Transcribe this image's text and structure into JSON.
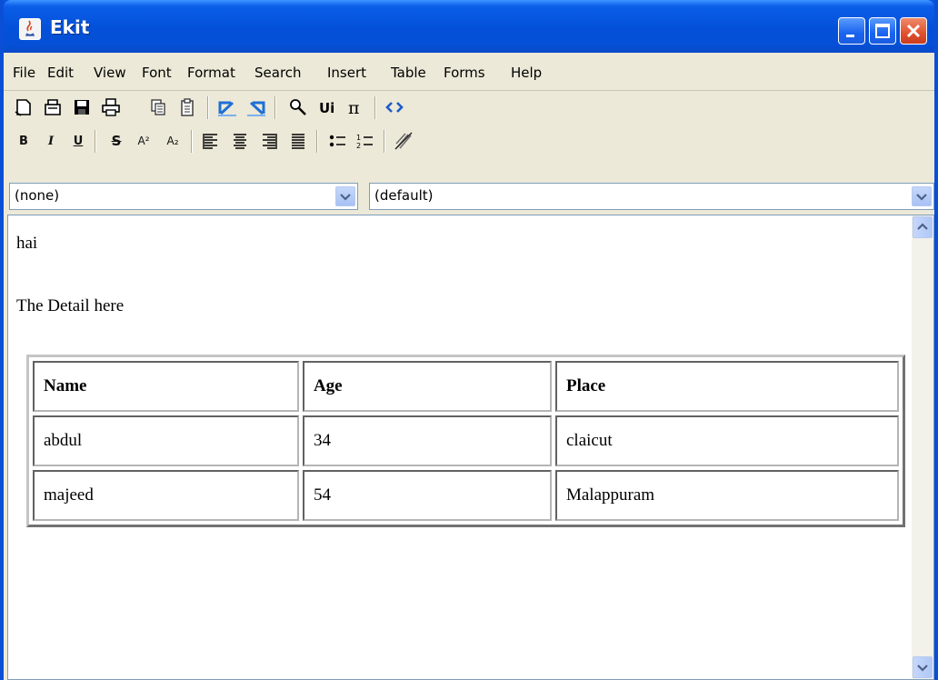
{
  "window": {
    "title": "Ekit"
  },
  "menu": [
    "File",
    "Edit",
    "View",
    "Font",
    "Format",
    "Search",
    "Insert",
    "Table",
    "Forms",
    "Help"
  ],
  "toolbar1": [
    "new-document-icon",
    "open-icon",
    "save-icon",
    "print-icon",
    "copy-icon",
    "paste-icon",
    "undo-icon",
    "redo-icon",
    "find-icon",
    "unicode-icon",
    "math-pi-icon",
    "view-source-icon"
  ],
  "toolbar2": {
    "bold": "B",
    "italic": "I",
    "underline": "U",
    "strike": "S",
    "superscript": "A²",
    "subscript": "A₂"
  },
  "style_combo": {
    "value": "(none)"
  },
  "font_combo": {
    "value": "(default)"
  },
  "document": {
    "line1": "hai",
    "line2": "The Detail here",
    "table": {
      "headers": [
        "Name",
        "Age",
        "Place"
      ],
      "rows": [
        [
          "abdul",
          "34",
          "claicut"
        ],
        [
          "majeed",
          "54",
          "Malappuram"
        ]
      ]
    }
  }
}
